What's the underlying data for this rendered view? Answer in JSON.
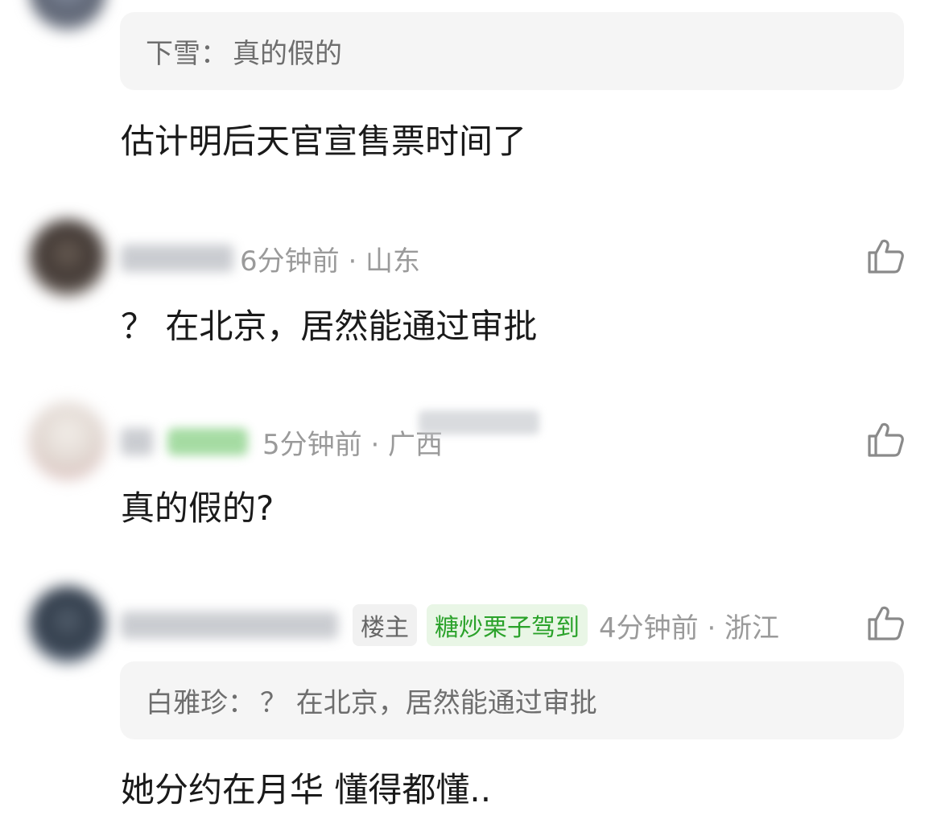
{
  "comments": [
    {
      "quote": {
        "author": "下雪",
        "sep": "：",
        "text": "真的假的"
      },
      "text": "估计明后天官宣售票时间了"
    },
    {
      "meta": "6分钟前 · 山东",
      "text": "？ 在北京，居然能通过审批"
    },
    {
      "meta": "5分钟前 · 广西",
      "text": "真的假的?"
    },
    {
      "owner_tag": "楼主",
      "badge": "糖炒栗子驾到",
      "meta": "4分钟前 · 浙江",
      "quote": {
        "author": "白雅珍",
        "sep": "：",
        "text": "？ 在北京，居然能通过审批"
      },
      "text": "她分约在月华 懂得都懂.."
    }
  ],
  "icons": {
    "like": "thumbs-up-icon"
  },
  "colors": {
    "meta": "#9a9a9a",
    "badge_text": "#2aa22a",
    "badge_bg": "#e9f6e6",
    "quote_bg": "#f5f5f5"
  }
}
